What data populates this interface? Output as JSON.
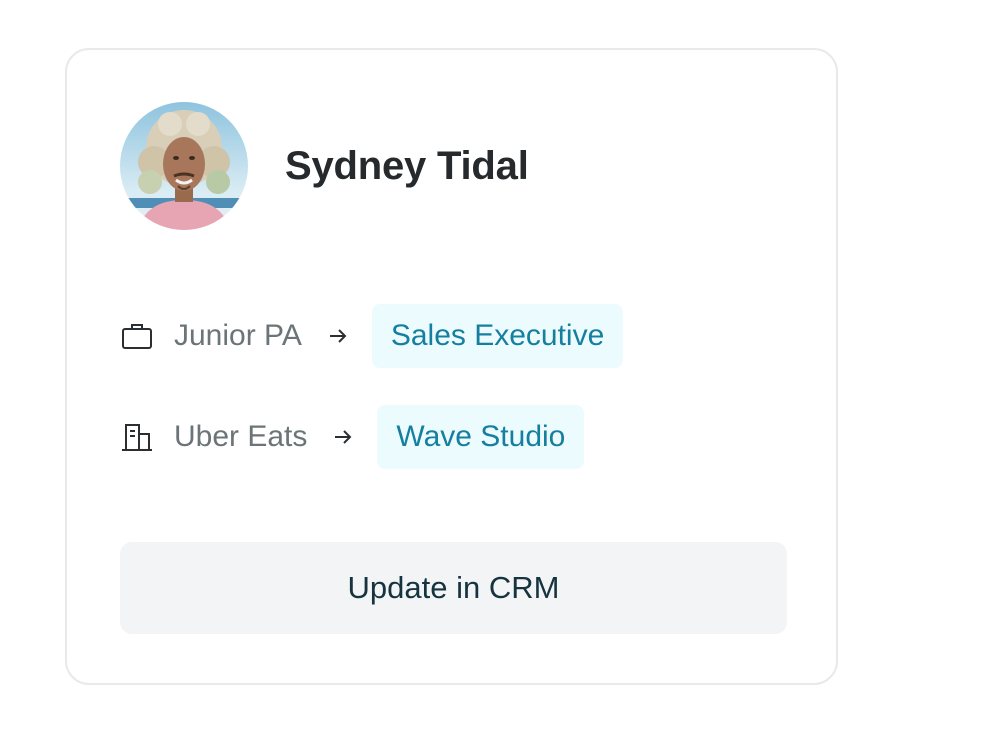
{
  "profile": {
    "name": "Sydney Tidal",
    "avatar_icon": "person-photo"
  },
  "changes": [
    {
      "icon": "briefcase-icon",
      "from": "Junior PA",
      "to": "Sales Executive"
    },
    {
      "icon": "building-icon",
      "from": "Uber Eats",
      "to": "Wave Studio"
    }
  ],
  "actions": {
    "update_label": "Update in CRM"
  },
  "colors": {
    "pill_bg": "#ecfbfd",
    "pill_text": "#157fa0",
    "button_bg": "#f2f4f5",
    "button_text": "#163440"
  }
}
